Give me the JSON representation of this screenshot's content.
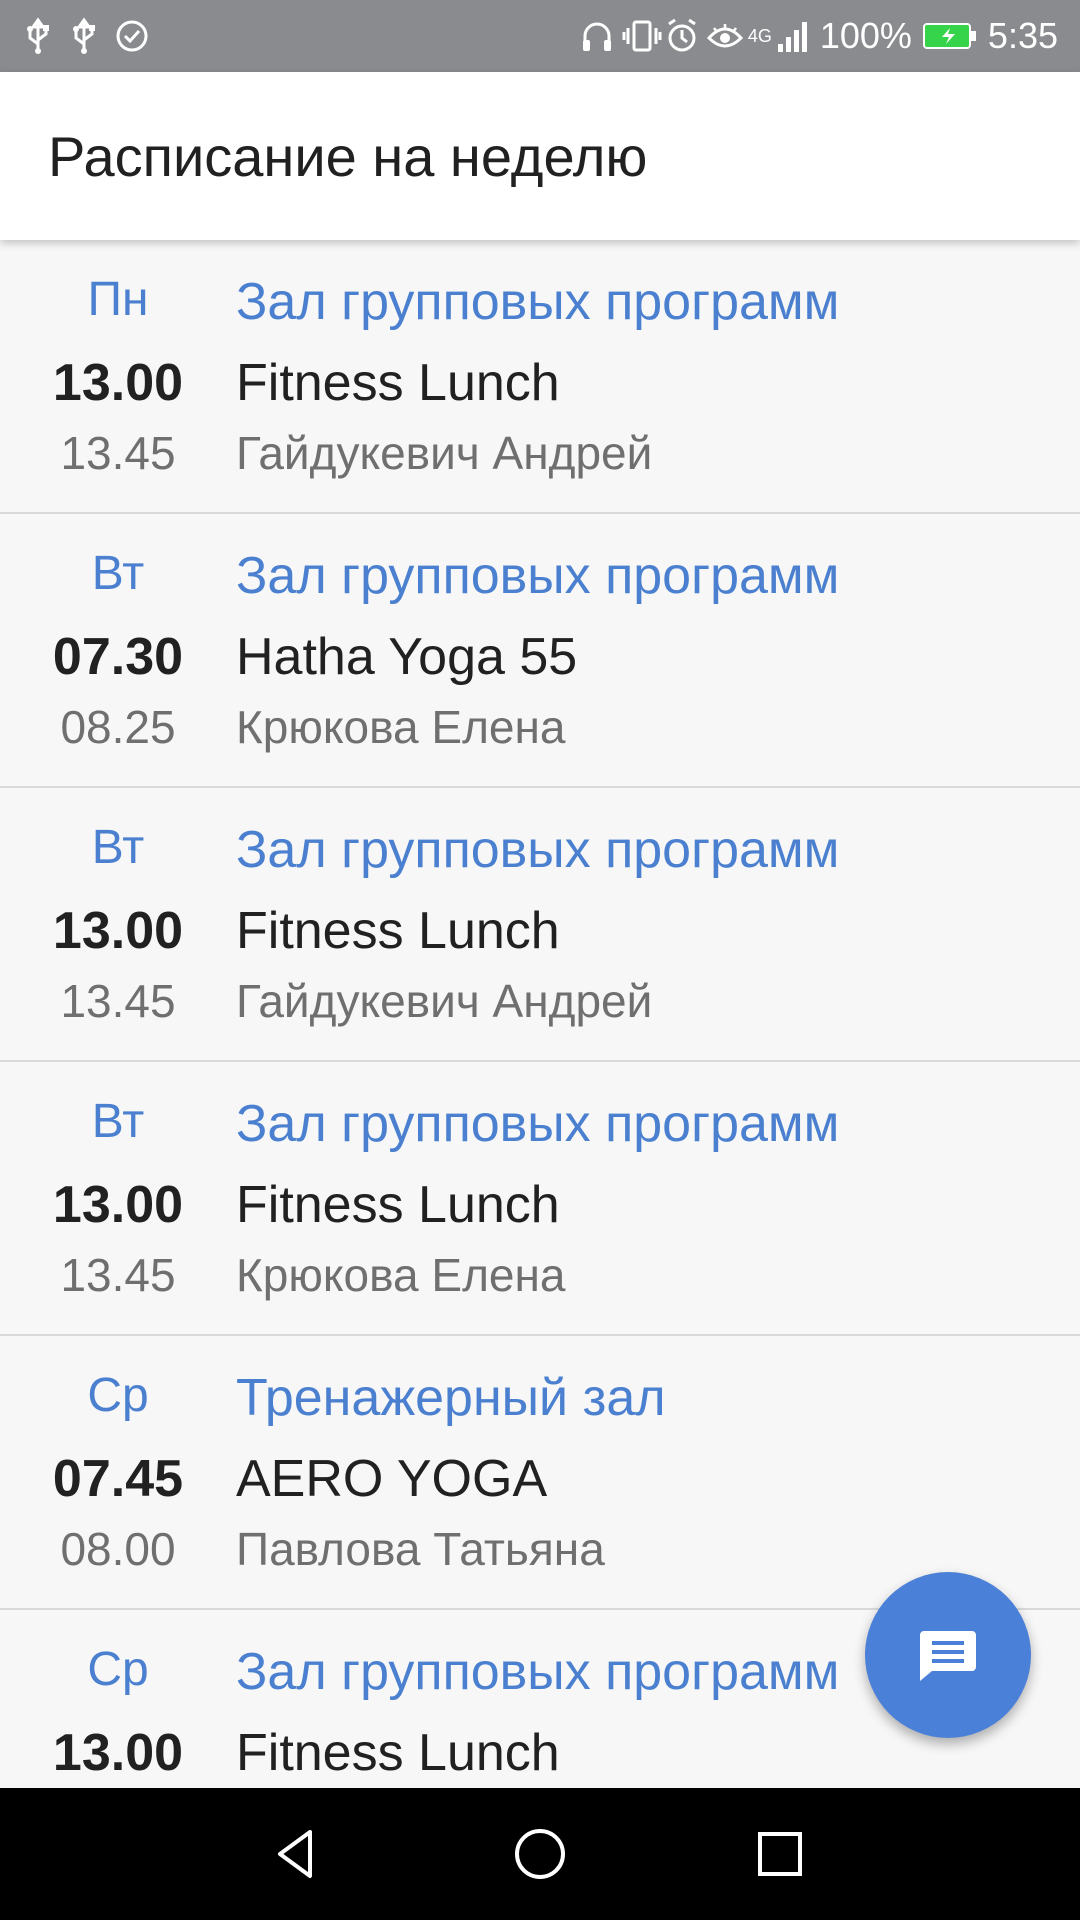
{
  "status_bar": {
    "battery_percent": "100%",
    "time": "5:35",
    "network_label": "4G",
    "icons_left": [
      "usb-icon",
      "usb-icon",
      "check-circle-icon"
    ],
    "icons_right": [
      "headphones-icon",
      "vibrate-icon",
      "alarm-icon",
      "eye-icon",
      "signal-icon",
      "battery-charging-icon"
    ],
    "battery_color": "#36d44a"
  },
  "app_bar": {
    "title": "Расписание на неделю"
  },
  "schedule": [
    {
      "day": "Пн",
      "start": "13.00",
      "end": "13.45",
      "hall": "Зал групповых программ",
      "class_name": "Fitness Lunch",
      "coach": "Гайдукевич Андрей"
    },
    {
      "day": "Вт",
      "start": "07.30",
      "end": "08.25",
      "hall": "Зал групповых программ",
      "class_name": "Hatha Yoga 55",
      "coach": "Крюкова Елена"
    },
    {
      "day": "Вт",
      "start": "13.00",
      "end": "13.45",
      "hall": "Зал групповых программ",
      "class_name": "Fitness Lunch",
      "coach": "Гайдукевич Андрей"
    },
    {
      "day": "Вт",
      "start": "13.00",
      "end": "13.45",
      "hall": "Зал групповых программ",
      "class_name": "Fitness Lunch",
      "coach": "Крюкова Елена"
    },
    {
      "day": "Ср",
      "start": "07.45",
      "end": "08.00",
      "hall": "Тренажерный зал",
      "class_name": "AERO YOGA",
      "coach": "Павлова Татьяна"
    },
    {
      "day": "Ср",
      "start": "13.00",
      "end": "",
      "hall": "Зал групповых программ",
      "class_name": "Fitness Lunch",
      "coach": ""
    }
  ],
  "fab": {
    "icon": "chat-icon"
  },
  "nav_bar": {
    "buttons": [
      "back-icon",
      "home-icon",
      "recents-icon"
    ]
  },
  "colors": {
    "accent": "#4a80cf",
    "fab": "#4a80d8",
    "status_bar": "#8a8b8e",
    "nav_bar": "#000000"
  }
}
